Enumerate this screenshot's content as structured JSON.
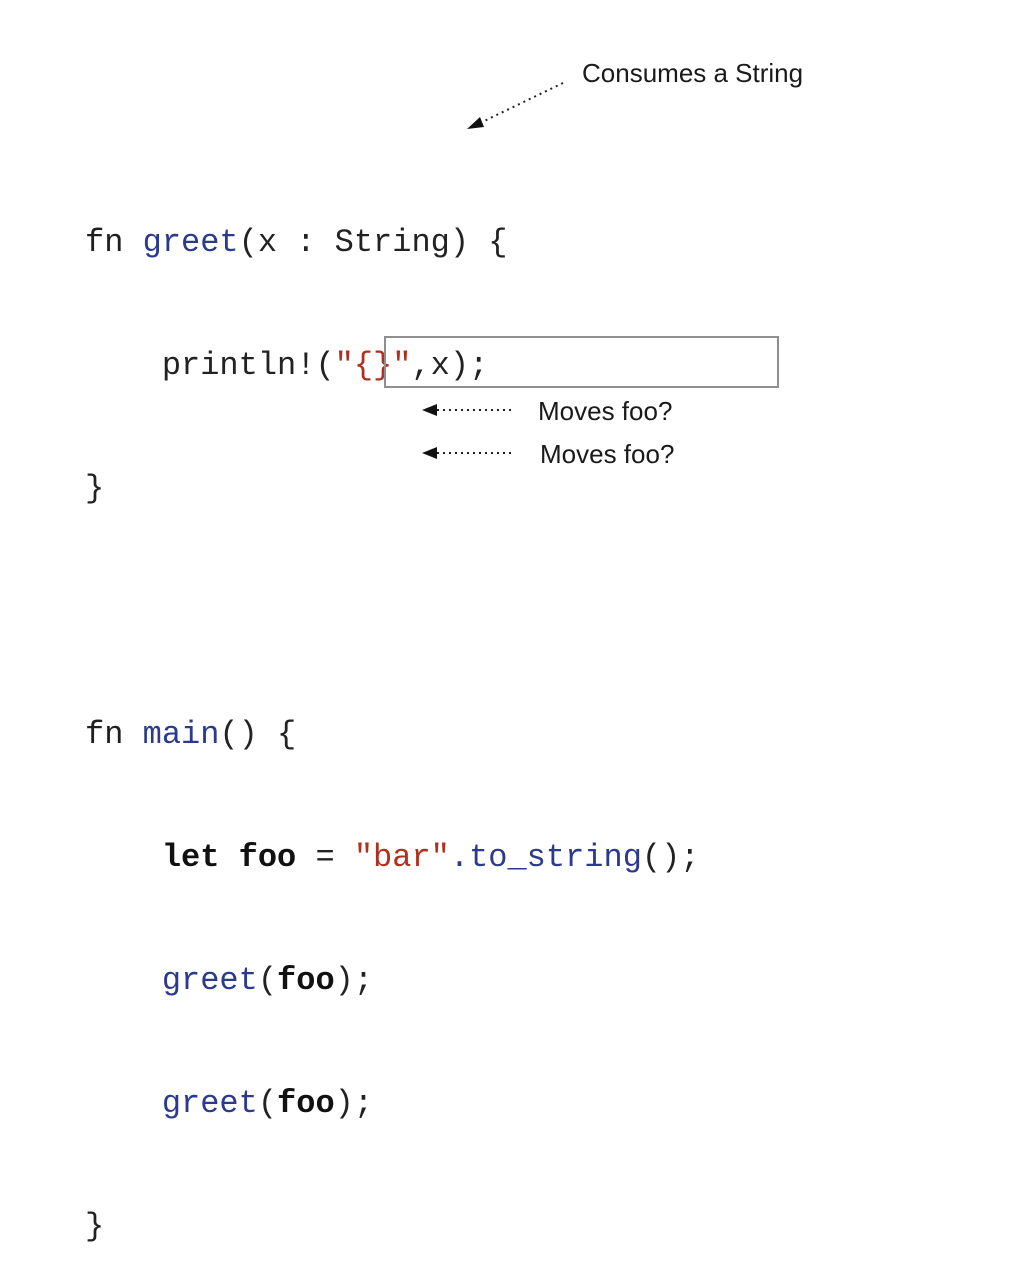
{
  "code": {
    "greet_fn": {
      "kw": "fn",
      "name": "greet",
      "params": "(x : String) {",
      "body_indent": "    ",
      "body_call": "println!(",
      "body_str": "\"{}\"",
      "body_rest": ",x);",
      "close": "}"
    },
    "main_fn": {
      "kw": "fn",
      "name": "main",
      "params": "() {",
      "let_kw": "let",
      "var": "foo",
      "eq": " = ",
      "str": "\"bar\"",
      "method": ".to_string",
      "method_end": "();",
      "call_name": "greet",
      "call_open": "(",
      "call_arg": "foo",
      "call_close": ");",
      "close": "}"
    }
  },
  "annotations": {
    "consumes": "Consumes a String",
    "moves_1": "Moves foo?",
    "moves_2": "Moves foo?"
  },
  "colors": {
    "function_name": "#2b3a8c",
    "string_literal": "#b0301f",
    "box_border": "#8f8f8f"
  }
}
